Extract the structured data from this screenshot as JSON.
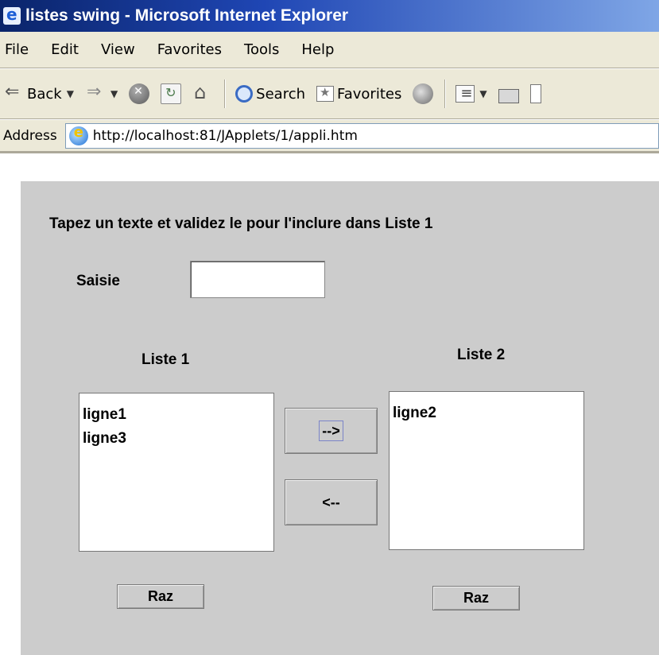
{
  "window": {
    "title": "listes swing - Microsoft Internet Explorer"
  },
  "menu": [
    "File",
    "Edit",
    "View",
    "Favorites",
    "Tools",
    "Help"
  ],
  "toolbar": {
    "back_label": "Back",
    "search_label": "Search",
    "favorites_label": "Favorites"
  },
  "address": {
    "label": "Address",
    "url": "http://localhost:81/JApplets/1/appli.htm"
  },
  "applet": {
    "instruction": "Tapez un texte et validez le pour l'inclure dans Liste 1",
    "input_label": "Saisie",
    "input_value": "",
    "list1": {
      "title": "Liste 1",
      "items": [
        "ligne1",
        "ligne3"
      ]
    },
    "list2": {
      "title": "Liste 2",
      "items": [
        "ligne2"
      ]
    },
    "move_right_label": "-->",
    "move_left_label": "<--",
    "raz1_label": "Raz",
    "raz2_label": "Raz"
  },
  "colors": {
    "titlebar": "#0a246a",
    "chrome": "#ece9d8",
    "applet_bg": "#cccccc"
  }
}
